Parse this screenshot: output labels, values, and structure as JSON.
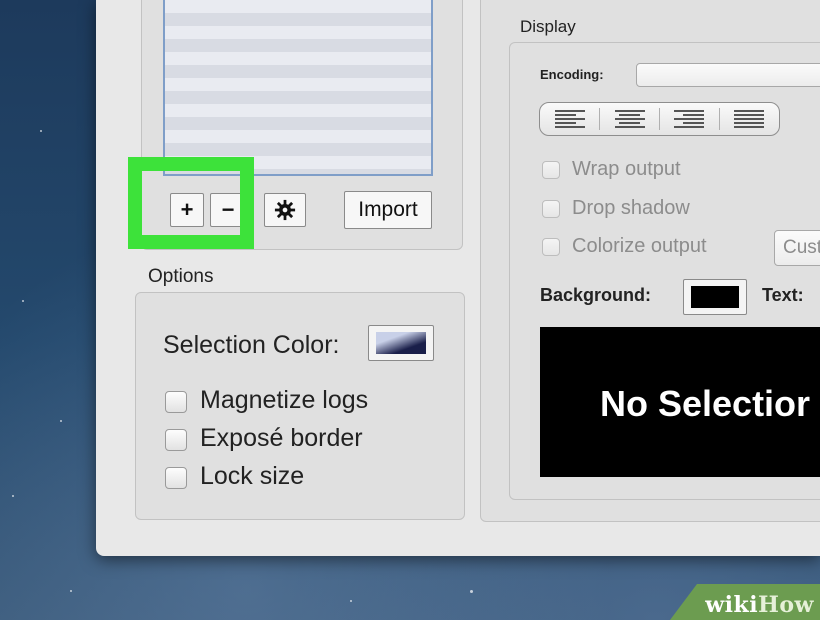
{
  "left": {
    "buttons": {
      "add": "+",
      "remove": "−",
      "settings_icon": "gear-icon",
      "import": "Import"
    }
  },
  "options": {
    "title": "Options",
    "selection_color_label": "Selection Color:",
    "checkboxes": [
      {
        "label": "Magnetize logs",
        "checked": false
      },
      {
        "label": "Exposé border",
        "checked": false
      },
      {
        "label": "Lock size",
        "checked": false
      }
    ]
  },
  "display": {
    "title": "Display",
    "encoding_label": "Encoding:",
    "encoding_value": "",
    "alignment": [
      "align-left",
      "align-center",
      "align-right",
      "align-justify"
    ],
    "checkboxes": [
      {
        "label": "Wrap output",
        "checked": false
      },
      {
        "label": "Drop shadow",
        "checked": false
      },
      {
        "label": "Colorize output",
        "checked": false
      }
    ],
    "custom_popup": "Cust",
    "background_label": "Background:",
    "background_color": "#000000",
    "text_label": "Text:",
    "preview_text": "No Selectior"
  },
  "watermark": {
    "part1": "wiki",
    "part2": "How"
  },
  "colors": {
    "highlight": "#3de23a",
    "selection_color_dark": "#1a1f4a",
    "selection_color_light": "#c8d0e8"
  }
}
